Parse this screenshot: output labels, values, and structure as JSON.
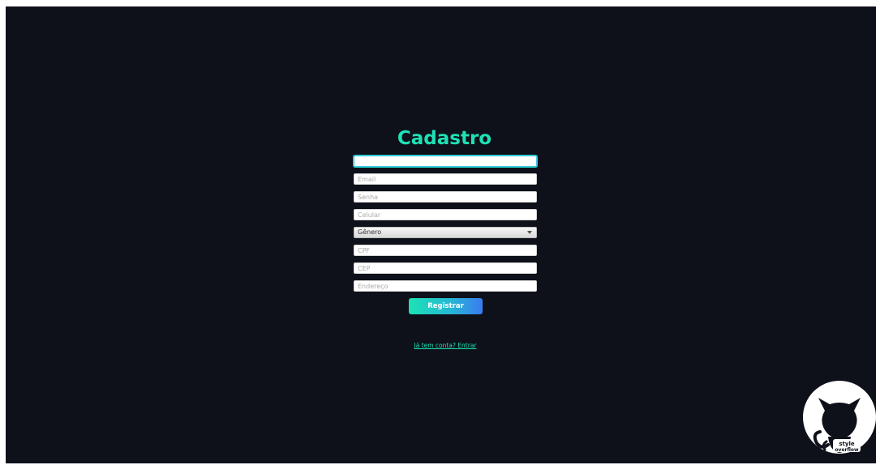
{
  "page": {
    "title": "Cadastro"
  },
  "form": {
    "name_value": "",
    "email_placeholder": "Email",
    "password_placeholder": "Senha",
    "phone_placeholder": "Celular",
    "gender_selected": "Gênero",
    "cpf_placeholder": "CPF",
    "cep_placeholder": "CEP",
    "address_placeholder": "Endereço",
    "submit_label": "Registrar",
    "login_link": "Já tem conta? Entrar"
  },
  "badge": {
    "logo_text_line1": "style",
    "logo_text_line2": "overflow",
    "icon": "octocat-icon"
  },
  "colors": {
    "background": "#0e111a",
    "accent": "#1de2b5",
    "button_gradient_end": "#3a7bf0"
  }
}
